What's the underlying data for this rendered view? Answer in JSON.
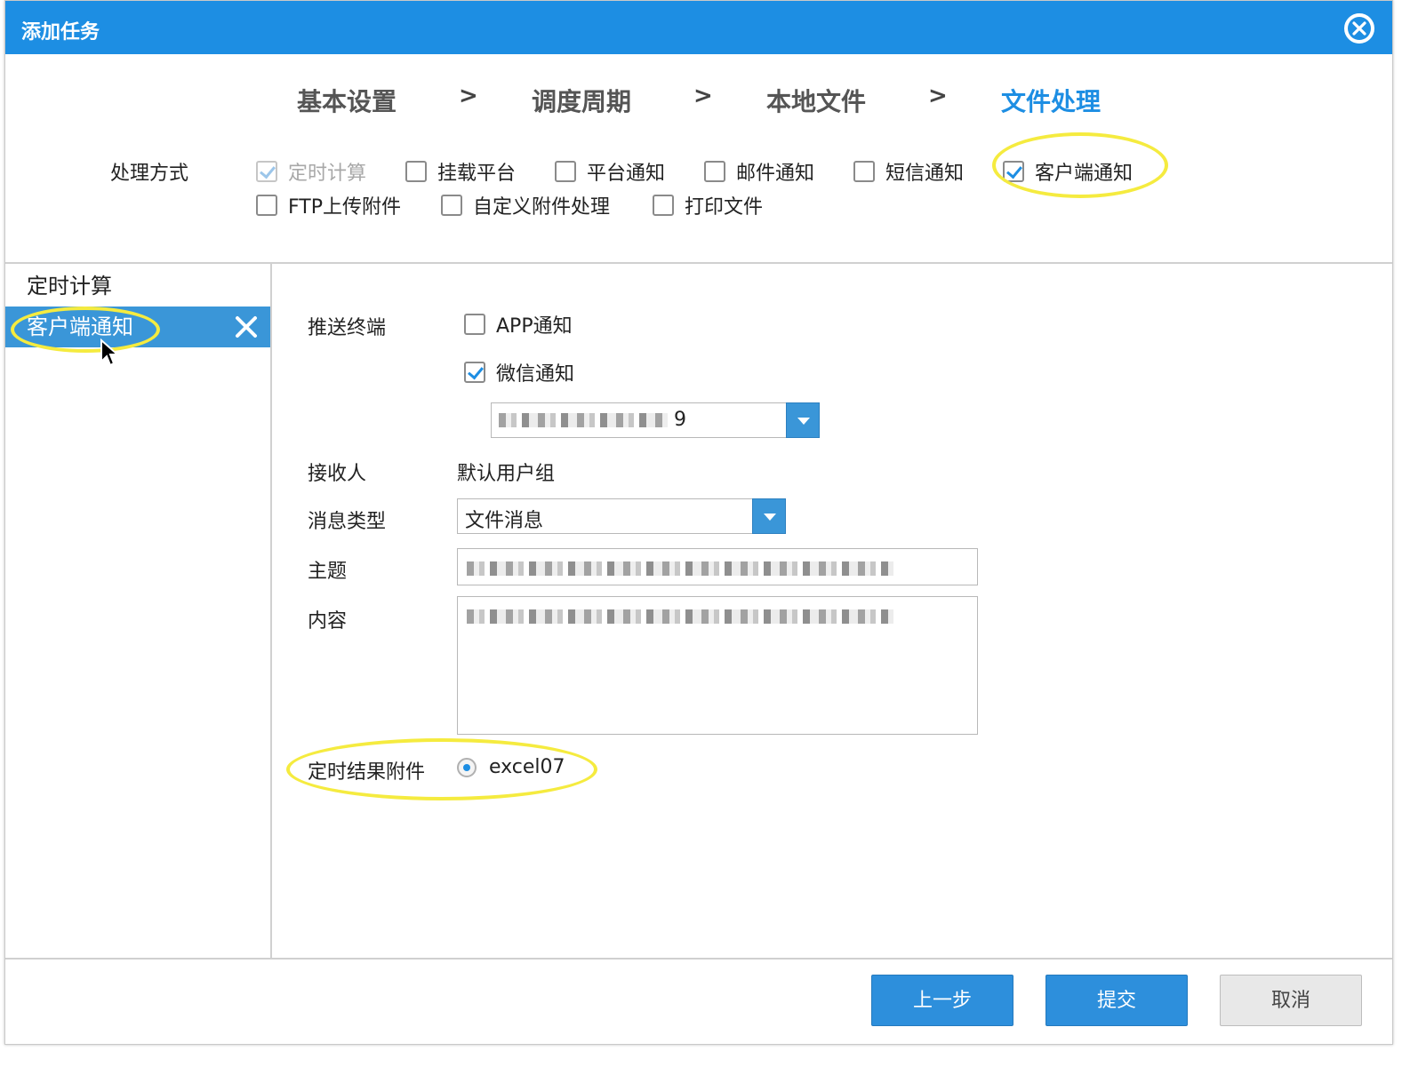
{
  "window": {
    "title": "添加任务"
  },
  "steps": [
    {
      "label": "基本设置",
      "active": false
    },
    {
      "label": "调度周期",
      "active": false
    },
    {
      "label": "本地文件",
      "active": false
    },
    {
      "label": "文件处理",
      "active": true
    }
  ],
  "step_separator": ">",
  "processing": {
    "label": "处理方式",
    "options": [
      {
        "label": "定时计算",
        "checked": true,
        "disabled": true
      },
      {
        "label": "挂载平台",
        "checked": false
      },
      {
        "label": "平台通知",
        "checked": false
      },
      {
        "label": "邮件通知",
        "checked": false
      },
      {
        "label": "短信通知",
        "checked": false
      },
      {
        "label": "客户端通知",
        "checked": true
      },
      {
        "label": "FTP上传附件",
        "checked": false
      },
      {
        "label": "自定义附件处理",
        "checked": false
      },
      {
        "label": "打印文件",
        "checked": false
      }
    ]
  },
  "sidebar": {
    "items": [
      {
        "label": "定时计算",
        "selected": false
      },
      {
        "label": "客户端通知",
        "selected": true
      }
    ]
  },
  "form": {
    "push_terminal_label": "推送终端",
    "app_notify": {
      "label": "APP通知",
      "checked": false
    },
    "wechat_notify": {
      "label": "微信通知",
      "checked": true
    },
    "wechat_account_suffix": "9",
    "receiver_label": "接收人",
    "receiver_value": "默认用户组",
    "message_type_label": "消息类型",
    "message_type_value": "文件消息",
    "subject_label": "主题",
    "content_label": "内容",
    "attachment_label": "定时结果附件",
    "attachment_option": "excel07"
  },
  "footer": {
    "prev_label": "上一步",
    "submit_label": "提交",
    "cancel_label": "取消"
  },
  "colors": {
    "accent": "#1d8ee3",
    "highlight": "#f5eb3f",
    "selected_bg": "#3a96d8"
  }
}
